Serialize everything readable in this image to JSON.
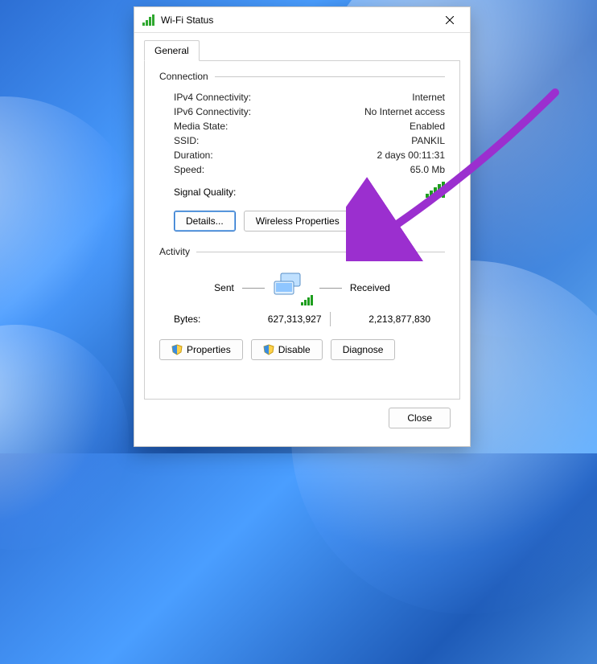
{
  "window": {
    "title": "Wi-Fi Status"
  },
  "tab": {
    "general": "General"
  },
  "groups": {
    "connection": "Connection",
    "activity": "Activity"
  },
  "connection": {
    "ipv4_label": "IPv4 Connectivity:",
    "ipv4_value": "Internet",
    "ipv6_label": "IPv6 Connectivity:",
    "ipv6_value": "No Internet access",
    "media_label": "Media State:",
    "media_value": "Enabled",
    "ssid_label": "SSID:",
    "ssid_value": "PANKIL",
    "duration_label": "Duration:",
    "duration_value": "2 days 00:11:31",
    "speed_label": "Speed:",
    "speed_value": "65.0 Mb",
    "signal_label": "Signal Quality:"
  },
  "buttons": {
    "details": "Details...",
    "wireless_properties": "Wireless Properties",
    "properties": "Properties",
    "disable": "Disable",
    "diagnose": "Diagnose",
    "close": "Close"
  },
  "activity": {
    "sent_label": "Sent",
    "received_label": "Received",
    "bytes_label": "Bytes:",
    "bytes_sent": "627,313,927",
    "bytes_received": "2,213,877,830"
  },
  "annotation": {
    "arrow_color": "#9b2fcf"
  }
}
